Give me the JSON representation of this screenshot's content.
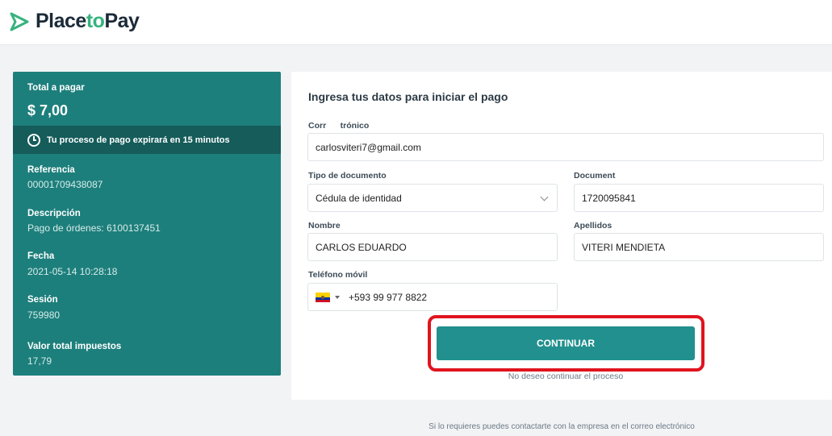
{
  "brand": {
    "place": "Place",
    "to": "to",
    "pay": "Pay",
    "accent": "#36b37e",
    "dark": "#1b2a38"
  },
  "summary": {
    "total_label": "Total a pagar",
    "total_value": "$ 7,00",
    "expire_text": "Tu proceso de pago expirará en 15 minutos",
    "fields": [
      {
        "label": "Referencia",
        "value": "00001709438087"
      },
      {
        "label": "Descripción",
        "value": "Pago de órdenes: 6100137451"
      },
      {
        "label": "Fecha",
        "value": "2021-05-14 10:28:18"
      },
      {
        "label": "Sesión",
        "value": "759980"
      },
      {
        "label": "Valor total impuestos",
        "value": "17,79"
      }
    ],
    "bg": "#1d7f7c"
  },
  "form": {
    "title": "Ingresa tus datos para iniciar el pago",
    "email_label": "Corr      trónico",
    "email_value": "carlosviteri7@gmail.com",
    "doc_type_label": "Tipo de documento",
    "doc_type_value": "Cédula de identidad",
    "doc_label": "Document",
    "doc_value": "1720095841",
    "name_label": "Nombre",
    "name_value": "CARLOS EDUARDO",
    "lastname_label": "Apellidos",
    "lastname_value": "VITERI MENDIETA",
    "phone_label": "Teléfono móvil",
    "phone_value": "+593 99 977 8822",
    "phone_country_icon": "ecuador-flag-icon"
  },
  "actions": {
    "continue_label": "CONTINUAR",
    "cancel_label": "No deseo continuar el proceso",
    "button_color": "#21908e",
    "highlight_color": "#e0141e"
  },
  "footer": {
    "contact_text": "Si lo requieres puedes contactarte con la empresa en el correo electrónico"
  }
}
